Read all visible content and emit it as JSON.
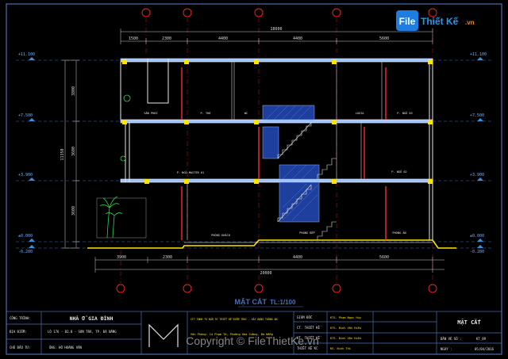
{
  "logo": {
    "part1": "File",
    "part2": "Thiết Kế",
    "part3": ".vn"
  },
  "drawing_title": "MẶT CẮT",
  "drawing_scale": "TL:1/100",
  "dims_top": {
    "total": "18600",
    "segments": [
      "1500",
      "2300",
      "4400",
      "4400",
      "5600"
    ]
  },
  "dims_bottom": {
    "total": "20000",
    "segments": [
      "3900",
      "2300",
      "4400",
      "5600"
    ]
  },
  "dims_side": {
    "total": "11350",
    "segments": [
      "3800",
      "3600",
      "3600",
      "2900"
    ]
  },
  "levels_left": [
    "+11.100",
    "+7.500",
    "+3.900",
    "±0.000",
    "-0.200"
  ],
  "levels_right": [
    "+11.100",
    "+7.500",
    "+3.900",
    "±0.000",
    "-0.200"
  ],
  "room_labels": [
    "SÂN PHƠI",
    "P. THỜ",
    "WC",
    "LOGIA",
    "P. NGỦ 03",
    "P. NGỦ MASTER 01",
    "P. NGỦ 02",
    "PHÒNG KHÁCH",
    "PHÒNG BẾP",
    "PHÒNG ĂN"
  ],
  "title_block": {
    "project_label": "CÔNG TRÌNH:",
    "project_name": "NHÀ Ở GIA ĐÌNH",
    "location_label": "ĐỊA ĐIỂM:",
    "location_value": "LÔ 176 - B2.8 - SƠN TRÀ, TP. ĐÀ NẴNG",
    "owner_label": "CHỦ ĐẦU TƯ:",
    "owner_value": "ÔNG: HỒ HOÀNG VĂN",
    "company_line1": "CTY TNHH TV ĐẦU TƯ THIẾT KẾ KIẾN TRÚC - XÂY DỰNG TƯỜNG AN",
    "company_line2": "Văn Phòng: 14 Phạm Tứ, Phường Hòa Cường, Đà Nẵng",
    "role_labels": [
      "GIÁM ĐỐC",
      "CT. THIẾT KẾ",
      "KT. THIẾT KẾ",
      "THIẾT KẾ KC"
    ],
    "name_values": [
      "KTS. Phạm Ngọc Huy",
      "KTS. Đinh Văn Hiếu",
      "KTS. Đinh Văn Hiếu",
      "KS. Đinh Thi"
    ],
    "sheet_title": "MẶT CẮT",
    "sheet_no_label": "BẢN VẼ SỐ :",
    "sheet_no": "KT_09",
    "date_label": "NGÀY :",
    "date_value": "05/04/2016"
  },
  "watermark": "Copyright © FileThietKe.vn",
  "colors": {
    "background": "#000000",
    "frame": "#4a6fb5",
    "wall": "#e8e8e8",
    "column": "#ffe400",
    "beam": "#ff3a3a",
    "dimension": "#d8d8d8",
    "axis": "#ff1a1a",
    "stair_fill": "#1e3f9e",
    "logo_blue": "#1e7de0",
    "logo_orange": "#ff8a00"
  }
}
